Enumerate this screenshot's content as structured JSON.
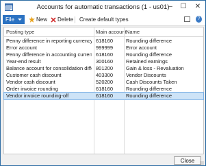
{
  "window": {
    "title": "Accounts for automatic transactions (1 - us01)",
    "min": "–",
    "max": "☐",
    "close": "✕"
  },
  "toolbar": {
    "file_label": "File",
    "new_label": "New",
    "delete_label": "Delete",
    "create_default_label": "Create default types"
  },
  "table": {
    "columns": [
      "Posting type",
      "Main account",
      "Name"
    ],
    "rows": [
      {
        "posting_type": "Penny difference in reporting currency",
        "main_account": "618160",
        "name": "Rounding difference"
      },
      {
        "posting_type": "Error account",
        "main_account": "999999",
        "name": "Error account"
      },
      {
        "posting_type": "Penny difference in accounting currency",
        "main_account": "618160",
        "name": "Rounding difference"
      },
      {
        "posting_type": "Year-end result",
        "main_account": "300160",
        "name": "Retained earnings"
      },
      {
        "posting_type": "Balance account for consolidation differences",
        "main_account": "801200",
        "name": "Gain & loss - Revaluation"
      },
      {
        "posting_type": "Customer cash discount",
        "main_account": "403300",
        "name": "Vendor Discounts"
      },
      {
        "posting_type": "Vendor cash discount",
        "main_account": "520200",
        "name": "Cash Discounts Taken"
      },
      {
        "posting_type": "Order invoice rounding",
        "main_account": "618160",
        "name": "Rounding difference"
      },
      {
        "posting_type": "Vendor invoice rounding-off",
        "main_account": "618160",
        "name": "Rounding difference"
      }
    ]
  },
  "footer": {
    "close_label": "Close"
  },
  "colors": {
    "file_button": "#2b72c2",
    "selected_row": "#cde3f7"
  }
}
